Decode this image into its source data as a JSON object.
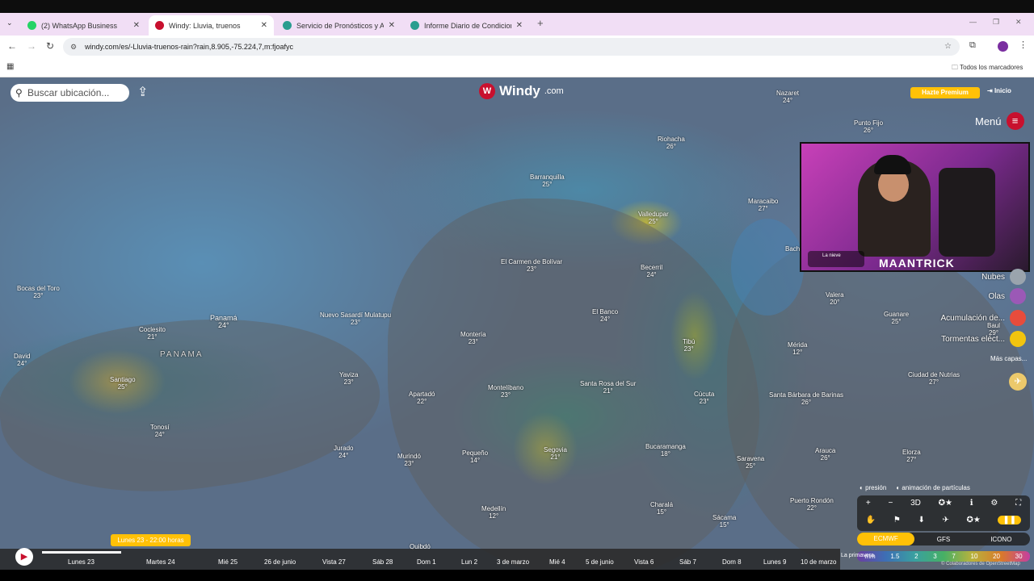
{
  "browser": {
    "tabs": [
      {
        "title": "(2) WhatsApp Business",
        "icon": "whatsapp-icon",
        "color": "#25d366"
      },
      {
        "title": "Windy: Lluvia, truenos",
        "icon": "windy-icon",
        "color": "#c8102e"
      },
      {
        "title": "Servicio de Pronósticos y Alerta",
        "icon": "weather-icon",
        "color": "#2a9d8f"
      },
      {
        "title": "Informe Diario de Condiciones",
        "icon": "report-icon",
        "color": "#2a9d8f"
      }
    ],
    "new_tab": "+",
    "url": "windy.com/es/-Lluvia-truenos-rain?rain,8.905,-75.224,7,m:fjoafyc",
    "bookmarks_label": "Todos los marcadores"
  },
  "windy": {
    "search_placeholder": "Buscar ubicación...",
    "logo_text": "Windy",
    "logo_suffix": ".com",
    "premium_label": "Hazte Premium",
    "login_label": "Inicio",
    "menu_label": "Menú",
    "layers": [
      {
        "label": "Nubes",
        "color": "#9aa4ad"
      },
      {
        "label": "Olas",
        "color": "#9b59b6"
      },
      {
        "label": "Acumulación de...",
        "color": "#e74c3c"
      },
      {
        "label": "Tormentas eléct...",
        "color": "#f1c40f"
      }
    ],
    "more_layers": "Más capas...",
    "toggle_pressure": "presión",
    "toggle_particles": "animación de partículas",
    "controls_row1": [
      "+",
      "−",
      "3D",
      "✪★",
      "ℹ",
      "⚙",
      "⛶"
    ],
    "controls_row2": [
      "✋",
      "⚑",
      "⬇",
      "✈",
      "✪★",
      "❚❚"
    ],
    "models": [
      "ECMWF",
      "GFS",
      "ICONO"
    ],
    "active_model": "ECMWF",
    "scale_unit": "mm",
    "scale_values": [
      "1.5",
      "2",
      "3",
      "7",
      "10",
      "20",
      "30"
    ],
    "date_pill": "Lunes 23 - 22:00 horas",
    "timeline_days": [
      "Lunes 23",
      "Martes 24",
      "Mié 25",
      "26 de junio",
      "Vista 27",
      "Sáb 28",
      "Dom 1",
      "Lun 2",
      "3 de marzo",
      "Mié 4",
      "5 de junio",
      "Vista 6",
      "Sáb 7",
      "Dom 8",
      "Lunes 9",
      "10 de marzo"
    ],
    "season_label": "La primavera",
    "credit": "© Colaboradores de OpenStreetMap",
    "country_label": "PANAMA"
  },
  "map_cities": [
    {
      "name": "Riohacha",
      "temp": "26°"
    },
    {
      "name": "Barranquilla",
      "temp": "25°"
    },
    {
      "name": "Valledupar",
      "temp": "25°"
    },
    {
      "name": "Maracaibo",
      "temp": "27°"
    },
    {
      "name": "Nazaret",
      "temp": "24°"
    },
    {
      "name": "Punto Fijo",
      "temp": "26°"
    },
    {
      "name": "El Carmen de Bolívar",
      "temp": "23°"
    },
    {
      "name": "Becerril",
      "temp": "24°"
    },
    {
      "name": "Bocas del Toro",
      "temp": "23°"
    },
    {
      "name": "Panamá",
      "temp": "24°"
    },
    {
      "name": "Nuevo Sasardí Mulatupu",
      "temp": "23°"
    },
    {
      "name": "Coclesito",
      "temp": "21°"
    },
    {
      "name": "Montería",
      "temp": "23°"
    },
    {
      "name": "El Banco",
      "temp": "24°"
    },
    {
      "name": "Tibú",
      "temp": "23°"
    },
    {
      "name": "Valera",
      "temp": "20°"
    },
    {
      "name": "Guanare",
      "temp": "25°"
    },
    {
      "name": "Mérida",
      "temp": "12°"
    },
    {
      "name": "David",
      "temp": "24°"
    },
    {
      "name": "Santiago",
      "temp": "25°"
    },
    {
      "name": "Yaviza",
      "temp": "23°"
    },
    {
      "name": "Apartadó",
      "temp": "22°"
    },
    {
      "name": "Montelíbano",
      "temp": "23°"
    },
    {
      "name": "Santa Rosa del Sur",
      "temp": "21°"
    },
    {
      "name": "Cúcuta",
      "temp": "23°"
    },
    {
      "name": "Santa Bárbara de Barinas",
      "temp": "26°"
    },
    {
      "name": "Ciudad de Nutrias",
      "temp": "27°"
    },
    {
      "name": "Tonosí",
      "temp": "24°"
    },
    {
      "name": "Jurado",
      "temp": "24°"
    },
    {
      "name": "Murindó",
      "temp": "23°"
    },
    {
      "name": "Pequeño",
      "temp": "14°"
    },
    {
      "name": "Segovia",
      "temp": "21°"
    },
    {
      "name": "Bucaramanga",
      "temp": "18°"
    },
    {
      "name": "Saravena",
      "temp": "25°"
    },
    {
      "name": "Arauca",
      "temp": "26°"
    },
    {
      "name": "Elorza",
      "temp": "27°"
    },
    {
      "name": "Medellín",
      "temp": "12°"
    },
    {
      "name": "Charalá",
      "temp": "15°"
    },
    {
      "name": "Sácama",
      "temp": "15°"
    },
    {
      "name": "Puerto Rondón",
      "temp": "22°"
    },
    {
      "name": "Quibdó",
      "temp": ""
    },
    {
      "name": "Bach",
      "temp": ""
    },
    {
      "name": "Baul",
      "temp": "29°"
    }
  ],
  "webcam": {
    "brand": "MAANTRICK",
    "notification": "La nieve"
  }
}
